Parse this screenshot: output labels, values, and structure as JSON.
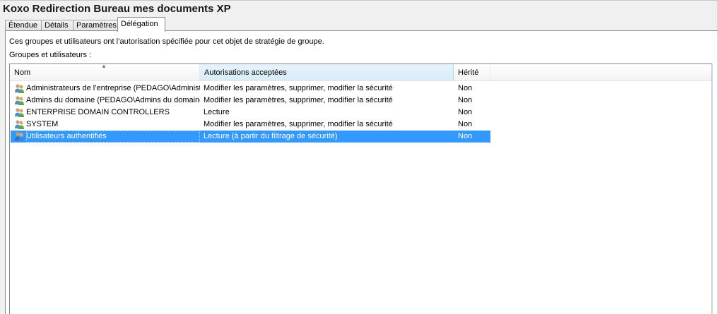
{
  "window": {
    "title": "Koxo Redirection Bureau mes documents XP"
  },
  "tabs": [
    {
      "label": "Étendue"
    },
    {
      "label": "Détails"
    },
    {
      "label": "Paramètres"
    },
    {
      "label": "Délégation",
      "active": true
    }
  ],
  "description": "Ces groupes et utilisateurs ont l’autorisation spécifiée pour cet objet de stratégie de groupe.",
  "groups_label": "Groupes et utilisateurs :",
  "columns": {
    "name": "Nom",
    "permissions": "Autorisations acceptées",
    "inherited": "Hérité"
  },
  "rows": [
    {
      "name": "Administrateurs de l’entreprise (PEDAGO\\Administ...",
      "permissions": "Modifier les paramètres, supprimer, modifier la sécurité",
      "inherited": "Non",
      "icon": "group-icon"
    },
    {
      "name": "Admins du domaine (PEDAGO\\Admins du domaine)",
      "permissions": "Modifier les paramètres, supprimer, modifier la sécurité",
      "inherited": "Non",
      "icon": "group-icon"
    },
    {
      "name": "ENTERPRISE DOMAIN CONTROLLERS",
      "permissions": "Lecture",
      "inherited": "Non",
      "icon": "group-icon"
    },
    {
      "name": "SYSTEM",
      "permissions": "Modifier les paramètres, supprimer, modifier la sécurité",
      "inherited": "Non",
      "icon": "group-icon"
    },
    {
      "name": "Utilisateurs authentifiés",
      "permissions": "Lecture (à partir du filtrage de sécurité)",
      "inherited": "Non",
      "icon": "group-icon",
      "selected": true
    }
  ],
  "colors": {
    "selection": "#3399ff",
    "sorted_header": "#d9ecf9"
  }
}
